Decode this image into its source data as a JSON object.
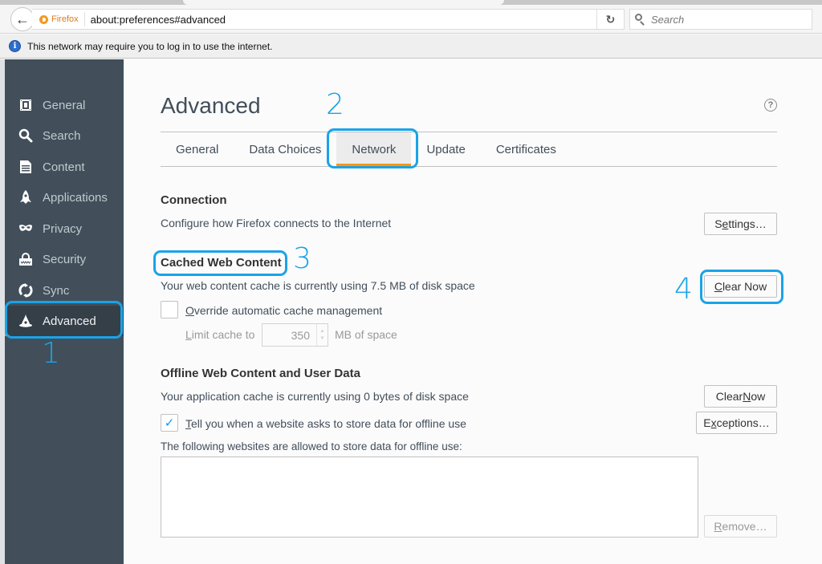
{
  "browser": {
    "identity_label": "Firefox",
    "url": "about:preferences#advanced",
    "search_placeholder": "Search",
    "notification": "This network may require you to log in to use the internet."
  },
  "sidebar": {
    "items": [
      {
        "label": "General",
        "icon": "general-icon"
      },
      {
        "label": "Search",
        "icon": "search-icon"
      },
      {
        "label": "Content",
        "icon": "content-icon"
      },
      {
        "label": "Applications",
        "icon": "applications-icon"
      },
      {
        "label": "Privacy",
        "icon": "privacy-mask-icon"
      },
      {
        "label": "Security",
        "icon": "security-lock-icon"
      },
      {
        "label": "Sync",
        "icon": "sync-icon"
      },
      {
        "label": "Advanced",
        "icon": "advanced-wizard-hat-icon",
        "selected": true
      }
    ]
  },
  "main": {
    "title": "Advanced",
    "help_glyph": "?",
    "tabs": [
      {
        "label": "General"
      },
      {
        "label": "Data Choices"
      },
      {
        "label": "Network",
        "active": true
      },
      {
        "label": "Update"
      },
      {
        "label": "Certificates"
      }
    ],
    "connection": {
      "heading": "Connection",
      "description": "Configure how Firefox connects to the Internet",
      "settings_button": {
        "pre": "S",
        "accel": "e",
        "post": "ttings…"
      }
    },
    "cache": {
      "heading": "Cached Web Content",
      "description": "Your web content cache is currently using 7.5 MB of disk space",
      "clear_button": {
        "pre": "",
        "accel": "C",
        "post": "lear Now"
      },
      "override_label": {
        "pre": "",
        "accel": "O",
        "post": "verride automatic cache management"
      },
      "override_checked": false,
      "limit_label": {
        "pre": "",
        "accel": "L",
        "post": "imit cache to"
      },
      "limit_value": "350",
      "limit_unit": "MB of space"
    },
    "offline": {
      "heading": "Offline Web Content and User Data",
      "description": "Your application cache is currently using 0 bytes of disk space",
      "clear_button": {
        "pre": "Clear ",
        "accel": "N",
        "post": "ow"
      },
      "tell_label": {
        "pre": "",
        "accel": "T",
        "post": "ell you when a website asks to store data for offline use"
      },
      "tell_checked": true,
      "exceptions_button": {
        "pre": "E",
        "accel": "x",
        "post": "ceptions…"
      },
      "allowed_label": "The following websites are allowed to store data for offline use:",
      "allowed_sites": [],
      "remove_button": {
        "pre": "",
        "accel": "R",
        "post": "emove…"
      }
    }
  },
  "annotations": [
    {
      "number": "1",
      "target": "Advanced sidebar item"
    },
    {
      "number": "2",
      "target": "Network tab"
    },
    {
      "number": "3",
      "target": "Cached Web Content heading"
    },
    {
      "number": "4",
      "target": "Clear Now button"
    }
  ],
  "colors": {
    "accent_orange": "#ff9500",
    "annotation_blue": "#1aa3e8",
    "sidebar_bg": "#424f5a",
    "sidebar_selected_bg": "#343f48",
    "checkbox_check": "#0996f8"
  }
}
